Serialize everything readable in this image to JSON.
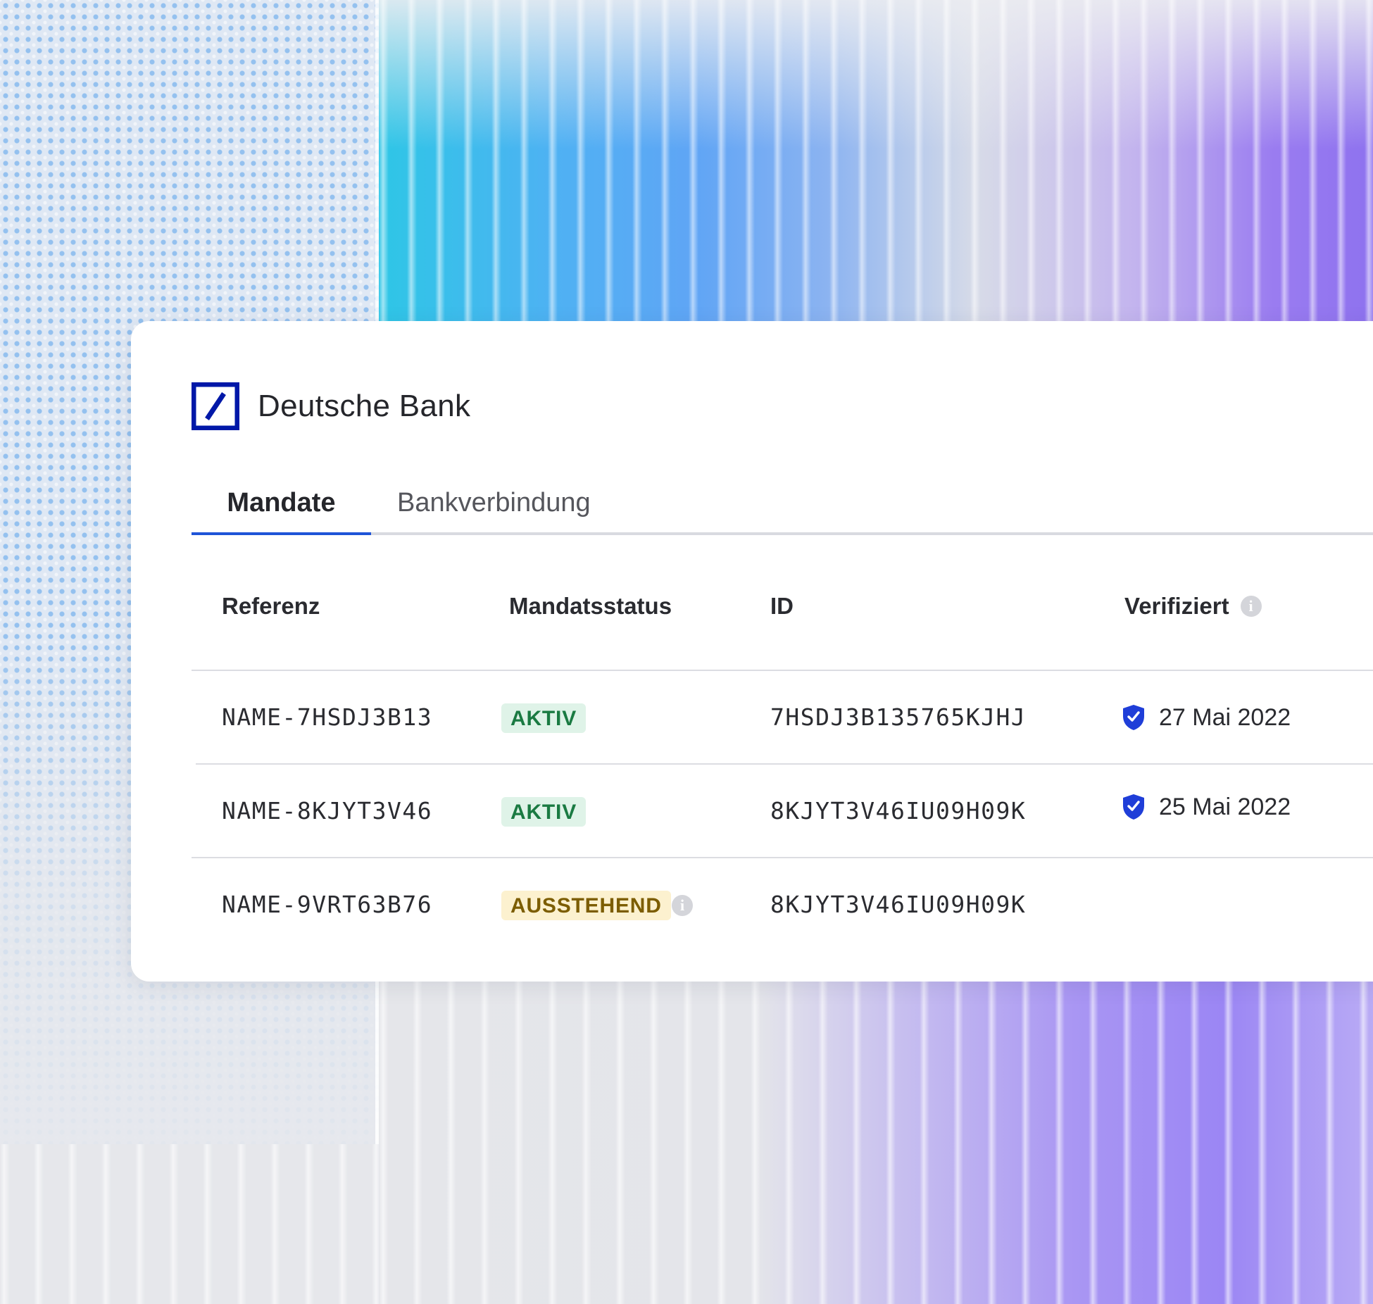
{
  "bank": {
    "name": "Deutsche Bank",
    "logo_color": "#0018a8"
  },
  "tabs": [
    {
      "label": "Mandate",
      "active": true
    },
    {
      "label": "Bankverbindung",
      "active": false
    }
  ],
  "table": {
    "columns": {
      "reference": "Referenz",
      "status": "Mandatsstatus",
      "id": "ID",
      "verified": "Verifiziert"
    },
    "rows": [
      {
        "reference": "NAME-7HSDJ3B13",
        "status": "AKTIV",
        "status_type": "active",
        "id": "7HSDJ3B135765KJHJ",
        "verified_date": "27 Mai 2022"
      },
      {
        "reference": "NAME-8KJYT3V46",
        "status": "AKTIV",
        "status_type": "active",
        "id": "8KJYT3V46IU09H09K",
        "verified_date": "25 Mai 2022"
      },
      {
        "reference": "NAME-9VRT63B76",
        "status": "AUSSTEHEND",
        "status_type": "pending",
        "id": "8KJYT3V46IU09H09K",
        "verified_date": ""
      }
    ]
  },
  "colors": {
    "accent": "#1f54d8",
    "active_badge_bg": "#dff3e8",
    "active_badge_text": "#1a7a42",
    "pending_badge_bg": "#fcf1cf",
    "pending_badge_text": "#7c5d00",
    "shield": "#1f3ed8"
  },
  "icons": {
    "info": "info-icon",
    "verified": "shield-check-icon",
    "logo": "deutsche-bank-logo"
  }
}
